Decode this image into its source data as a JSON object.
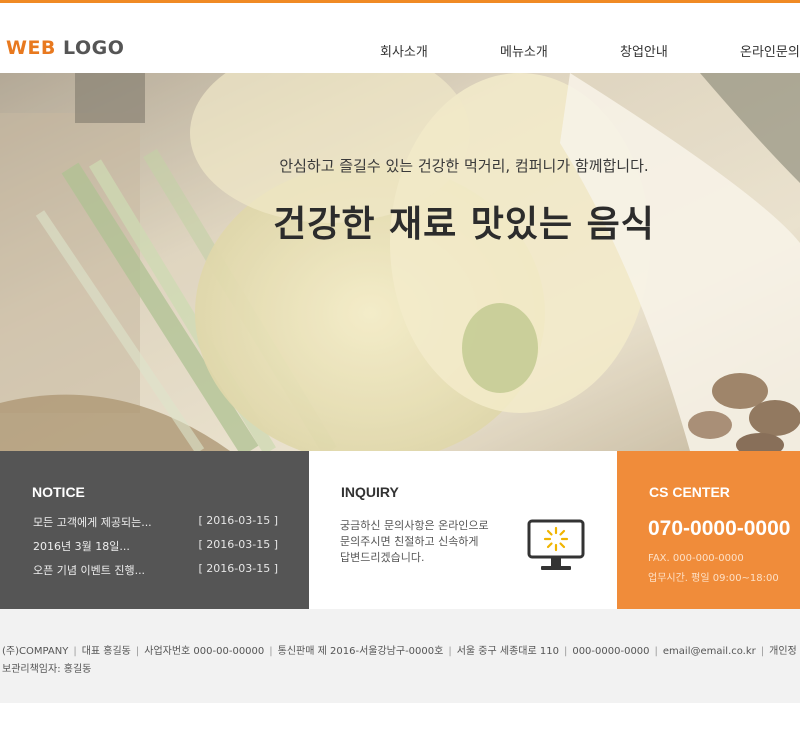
{
  "header": {
    "logo_accent": "WEB",
    "logo_rest": "LOGO",
    "nav": [
      "회사소개",
      "메뉴소개",
      "창업안내",
      "온라인문의"
    ]
  },
  "hero": {
    "subtitle": "안심하고 즐길수 있는 건강한 먹거리, 컴퍼니가 함께합니다.",
    "title": "건강한 재료 맛있는 음식"
  },
  "notice": {
    "heading": "NOTICE",
    "items": [
      {
        "title": "모든 고객에게 제공되는...",
        "date": "[ 2016-03-15 ]"
      },
      {
        "title": "2016년 3월 18일...",
        "date": "[ 2016-03-15 ]"
      },
      {
        "title": "오픈 기념 이벤트 진행...",
        "date": "[ 2016-03-15 ]"
      }
    ]
  },
  "inquiry": {
    "heading": "INQUIRY",
    "text": "궁금하신 문의사항은 온라인으로 문의주시면 친절하고 신속하게 답변드리겠습니다."
  },
  "cs": {
    "heading": "CS CENTER",
    "phone": "070-0000-0000",
    "fax": "FAX. 000-000-0000",
    "hours": "업무시간. 평일 09:00~18:00"
  },
  "footer": {
    "items": [
      "(주)COMPANY",
      "대표 홍길동",
      "사업자번호 000-00-00000",
      "통신판매 제 2016-서울강남구-0000호",
      "서울 중구 세종대로 110",
      "000-0000-0000",
      "email@email.co.kr",
      "개인정"
    ],
    "line2": "보관리책임자: 홍길동"
  },
  "colors": {
    "accent": "#f08a24",
    "notice_bg": "#555555",
    "cs_bg": "#f08c3a",
    "footer_bg": "#f2f2f2"
  }
}
